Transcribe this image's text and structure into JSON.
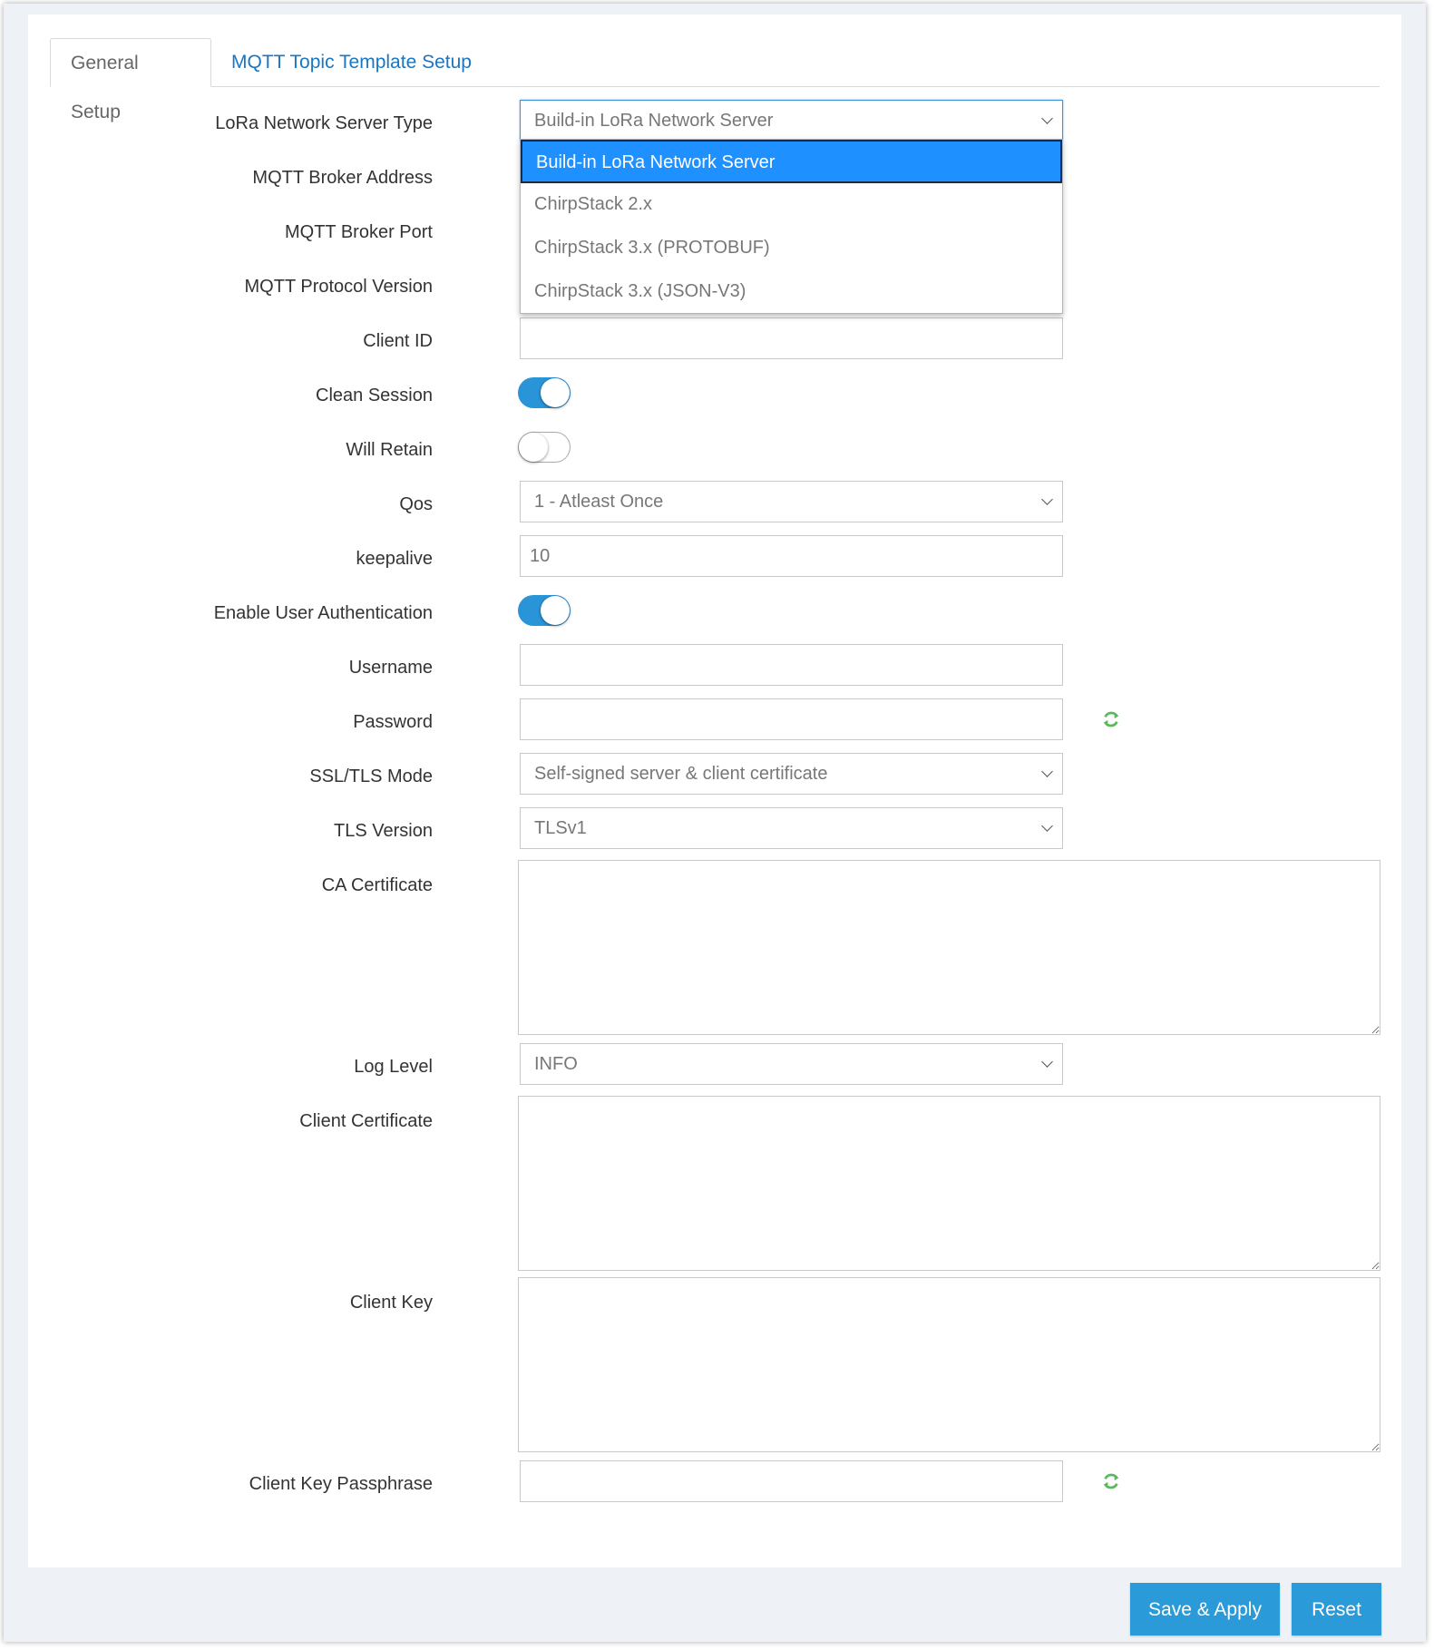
{
  "tabs": {
    "general": "General Setup",
    "topic": "MQTT Topic Template Setup"
  },
  "labels": {
    "server_type": "LoRa Network Server Type",
    "broker_address": "MQTT Broker Address",
    "broker_port": "MQTT Broker Port",
    "protocol_version": "MQTT Protocol Version",
    "client_id": "Client ID",
    "clean_session": "Clean Session",
    "will_retain": "Will Retain",
    "qos": "Qos",
    "keepalive": "keepalive",
    "enable_auth": "Enable User Authentication",
    "username": "Username",
    "password": "Password",
    "ssl_mode": "SSL/TLS Mode",
    "tls_version": "TLS Version",
    "ca_cert": "CA Certificate",
    "log_level": "Log Level",
    "client_cert": "Client Certificate",
    "client_key": "Client Key",
    "client_key_pass": "Client Key Passphrase"
  },
  "values": {
    "server_type": "Build-in LoRa Network Server",
    "qos": "1 - Atleast Once",
    "keepalive": "10",
    "ssl_mode": "Self-signed server & client certificate",
    "tls_version": "TLSv1",
    "log_level": "INFO",
    "clean_session": true,
    "will_retain": false,
    "enable_auth": true
  },
  "server_type_options": [
    "Build-in LoRa Network Server",
    "ChirpStack 2.x",
    "ChirpStack 3.x (PROTOBUF)",
    "ChirpStack 3.x (JSON-V3)"
  ],
  "buttons": {
    "save": "Save & Apply",
    "reset": "Reset"
  },
  "icons": {
    "refresh": "refresh-icon"
  },
  "colors": {
    "accent": "#2a94d8",
    "selected_option": "#1e90ff",
    "link": "#1a76c2",
    "refresh": "#5cb85c"
  }
}
